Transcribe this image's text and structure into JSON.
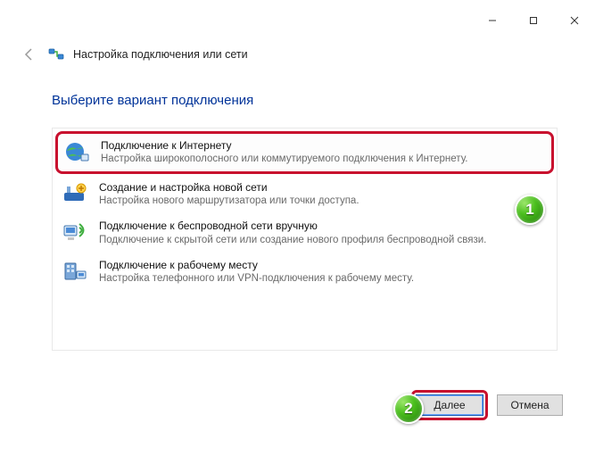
{
  "titlebar": {
    "minimize_name": "minimize",
    "maximize_name": "maximize",
    "close_name": "close"
  },
  "header": {
    "title": "Настройка подключения или сети"
  },
  "heading": "Выберите вариант подключения",
  "options": [
    {
      "title": "Подключение к Интернету",
      "desc": "Настройка широкополосного или коммутируемого подключения к Интернету.",
      "selected": true
    },
    {
      "title": "Создание и настройка новой сети",
      "desc": "Настройка нового маршрутизатора или точки доступа."
    },
    {
      "title": "Подключение к беспроводной сети вручную",
      "desc": "Подключение к скрытой сети или создание нового профиля беспроводной связи."
    },
    {
      "title": "Подключение к рабочему месту",
      "desc": "Настройка телефонного или VPN-подключения к рабочему месту."
    }
  ],
  "footer": {
    "next": "Далее",
    "cancel": "Отмена"
  },
  "badges": {
    "one": "1",
    "two": "2"
  }
}
